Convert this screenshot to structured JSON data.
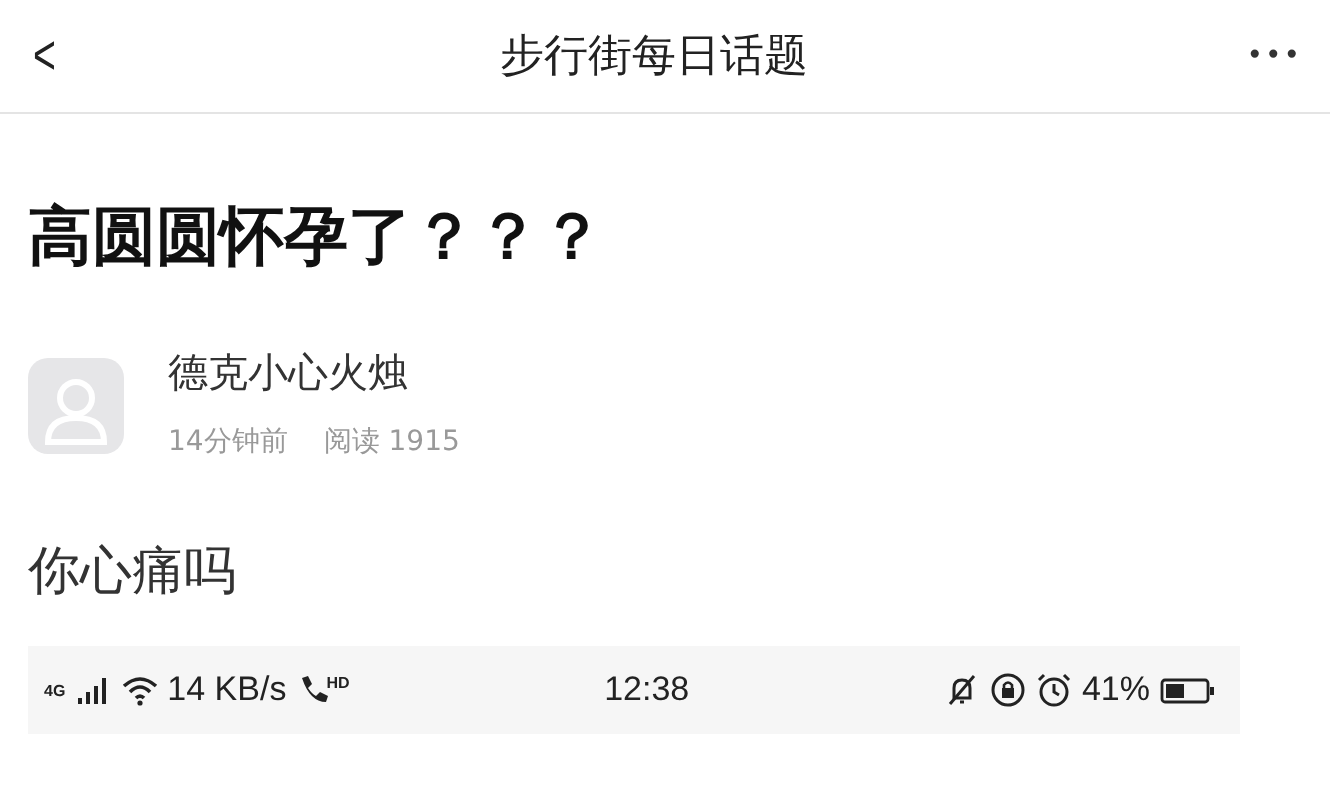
{
  "header": {
    "back": "<",
    "title": "步行街每日话题",
    "more": "•••"
  },
  "post": {
    "title": "高圆圆怀孕了？？？",
    "author": "德克小心火烛",
    "time": "14分钟前",
    "views": "阅读 1915",
    "body": "你心痛吗"
  },
  "embedded_status_bar": {
    "network": "4G",
    "speed": "14 KB/s",
    "call_badge": "HD",
    "clock": "12:38",
    "battery": "41%"
  }
}
